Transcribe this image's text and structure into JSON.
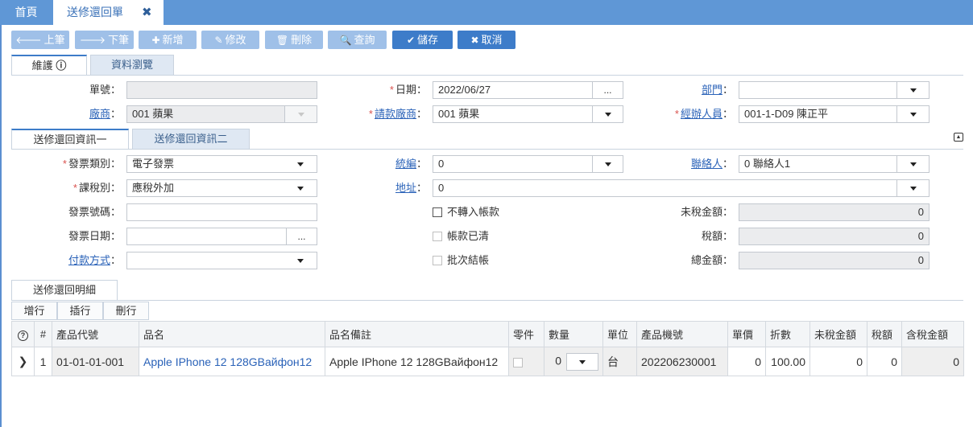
{
  "tabs": {
    "home": "首頁",
    "current": "送修還回單"
  },
  "toolbar": {
    "prev": "上筆",
    "next": "下筆",
    "add": "新增",
    "edit": "修改",
    "delete": "刪除",
    "query": "查詢",
    "save": "儲存",
    "cancel": "取消"
  },
  "form_tabs": {
    "maintain": "維護",
    "browse": "資料瀏覽"
  },
  "header": {
    "doc_no_label": "單號：",
    "doc_no_value": "",
    "date_label": "日期：",
    "date_value": "2022/06/27",
    "dept_label": "部門",
    "dept_value": "",
    "vendor_label": "廠商",
    "vendor_value": "001 蘋果",
    "pay_vendor_label": "請款廠商",
    "pay_vendor_value": "001 蘋果",
    "handler_label": "經辦人員",
    "handler_value": "001-1-D09 陳正平"
  },
  "info_tabs": {
    "tab1": "送修還回資訊一",
    "tab2": "送修還回資訊二"
  },
  "info": {
    "invoice_type_label": "發票類別：",
    "invoice_type_value": "電子發票",
    "tax_id_label": "統編",
    "tax_id_value": "0",
    "contact_label": "聯絡人",
    "contact_value": "0 聯絡人1",
    "tax_type_label": "課稅別：",
    "tax_type_value": "應稅外加",
    "address_label": "地址",
    "address_value": "0",
    "invoice_no_label": "發票號碼：",
    "invoice_no_value": "",
    "no_transfer_label": "不轉入帳款",
    "pretax_label": "未稅金額：",
    "pretax_value": "0",
    "invoice_date_label": "發票日期：",
    "invoice_date_value": "",
    "cleared_label": "帳款已清",
    "tax_label": "稅額：",
    "tax_value": "0",
    "payment_label": "付款方式",
    "payment_value": "",
    "batch_label": "批次結帳",
    "total_label": "總金額：",
    "total_value": "0",
    "ellipsis": "..."
  },
  "detail_tab": "送修還回明細",
  "grid_buttons": {
    "add_row": "增行",
    "insert_row": "插行",
    "delete_row": "刪行"
  },
  "grid": {
    "columns": [
      "#",
      "產品代號",
      "品名",
      "品名備註",
      "零件",
      "數量",
      "單位",
      "產品機號",
      "單價",
      "折數",
      "未稅金額",
      "稅額",
      "含稅金額"
    ],
    "rows": [
      {
        "no": "1",
        "code": "01-01-01-001",
        "name": "Apple IPhone 12 128GВайфон12",
        "note": "Apple IPhone 12 128GВайфон12",
        "qty": "0",
        "unit": "台",
        "serial": "202206230001",
        "price": "0",
        "discount": "100.00",
        "pretax": "0",
        "tax": "0",
        "total": "0"
      }
    ]
  },
  "colors": {
    "topbar": "#5f97d6",
    "primary_button": "#3d7cc9",
    "disabled_button": "#9fc0e8",
    "link": "#2a62b8",
    "required": "#d9534f"
  }
}
